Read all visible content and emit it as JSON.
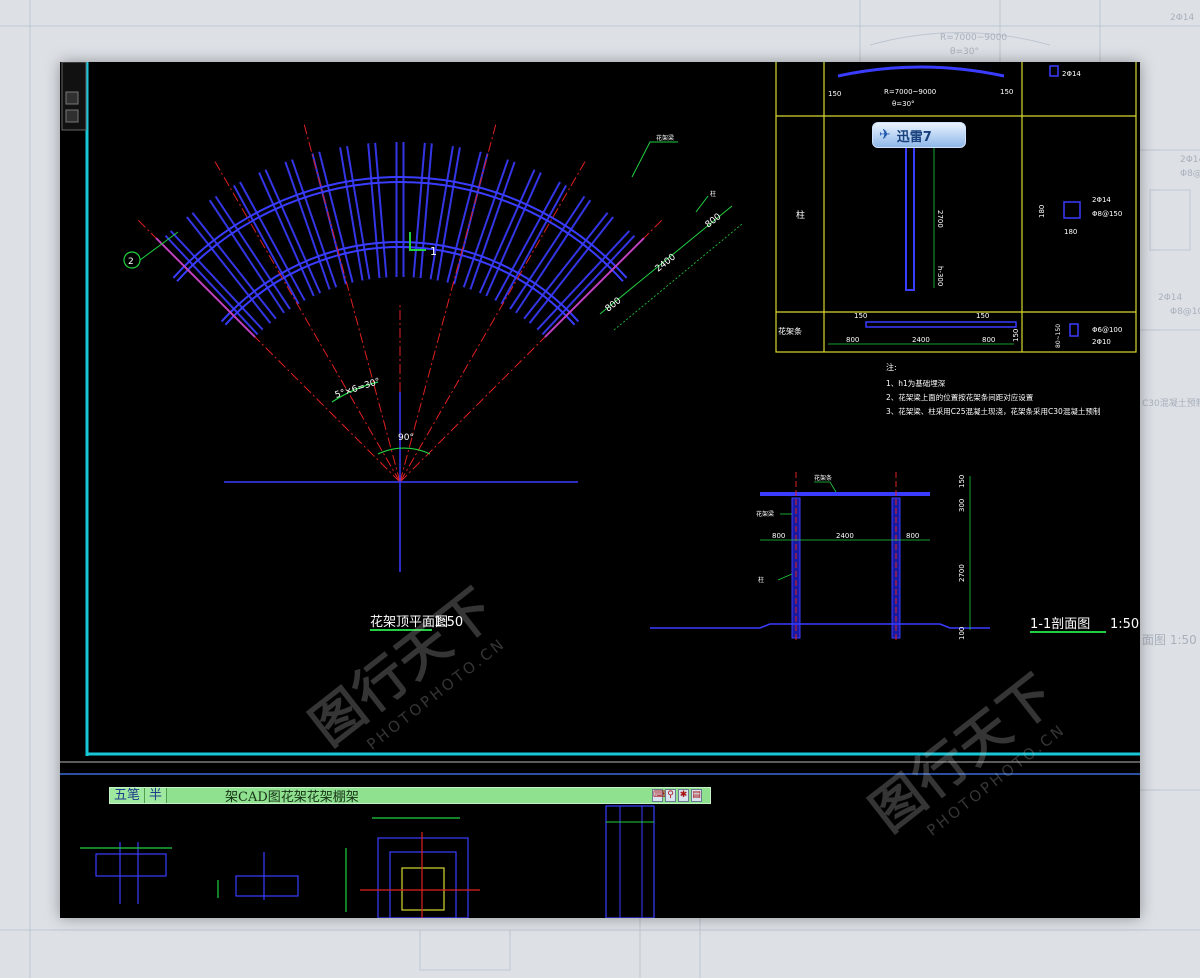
{
  "background": {
    "labels": [
      "R=7000~9000",
      "θ=30°",
      "2Φ14",
      "2Φ14",
      "Φ8@150",
      "2Φ14",
      "Φ8@100",
      "C30混凝土预制",
      "面图 1:50"
    ]
  },
  "plan_view": {
    "title": "花架顶平面图",
    "scale": "1:50",
    "angle_total": "90°",
    "angle_step": "5°×6=30°",
    "section_mark": "1",
    "dim_right_outer": "800",
    "dim_right_mid": "2400",
    "dim_right_inner": "800",
    "axis_callout": "2",
    "beam_callout": "花架梁",
    "end_callout": "柱"
  },
  "detail_table": {
    "top_row": {
      "dim_left": "150",
      "dim_right": "150",
      "radius_text": "R=7000~9000",
      "angle_text": "θ=30°",
      "rebar_text": "2Φ14"
    },
    "column_row": {
      "label": "柱",
      "dim_height": "2700",
      "dim_base": "h-300",
      "rebar_top": "2Φ14",
      "rebar_stirrup": "Φ8@150",
      "dim_side": "180",
      "dim_bottom": "180"
    },
    "strip_row": {
      "label": "花架条",
      "dim_top_left": "150",
      "dim_top_right": "150",
      "dim_left": "800",
      "dim_mid": "2400",
      "dim_right": "800",
      "dim_height": "150",
      "dim_side": "80~150",
      "rebar_stirrup": "Φ6@100",
      "rebar_bottom": "2Φ10"
    }
  },
  "notes": {
    "heading": "注:",
    "items": [
      "1、h1为基础埋深",
      "2、花架梁上面的位置按花架条间距对应设置",
      "3、花架梁、柱采用C25混凝土现浇，花架条采用C30混凝土预制"
    ]
  },
  "section_view": {
    "title": "1-1剖面图",
    "scale": "1:50",
    "label_beam": "花架条",
    "label_strip": "花架梁",
    "label_column": "柱",
    "dim_left": "800",
    "dim_mid": "2400",
    "dim_right": "800",
    "dim_v_top": "150",
    "dim_v_beam": "300",
    "dim_v_column": "2700",
    "dim_v_base": "100"
  },
  "ime_bar": {
    "mode": "五笔",
    "width": "半",
    "text": "架CAD图花架花架棚架"
  },
  "overlay": {
    "xunlei_label": "迅雷7"
  },
  "watermarks": [
    {
      "logo": "图行天下",
      "site": "PHOTOPHOTO.CN"
    },
    {
      "logo": "图行天下",
      "site": "PHOTOPHOTO.CN"
    }
  ],
  "colors": {
    "canvas": "#000000",
    "frame": "#18c8d8",
    "rafter": "#3a3cff",
    "centerline": "#e02020",
    "dimension": "#20d040",
    "table_grid": "#d8d830",
    "text": "#ffffff"
  }
}
